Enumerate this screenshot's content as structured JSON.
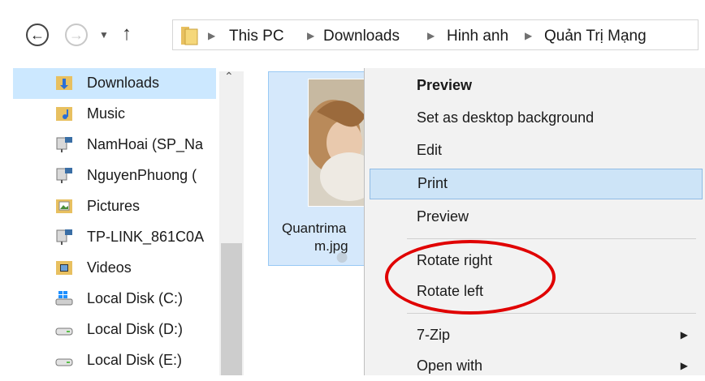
{
  "address_bar": {
    "back_icon": "back-arrow-icon",
    "forward_icon": "forward-arrow-icon",
    "recent_icon": "chevron-down-icon",
    "up_icon": "up-arrow-icon",
    "folder_icon": "folder-icon",
    "breadcrumbs": [
      "This PC",
      "Downloads",
      "Hinh anh",
      "Quản Trị Mạng"
    ]
  },
  "sidebar": {
    "items": [
      {
        "label": "Downloads",
        "icon": "downloads-folder-icon",
        "selected": true
      },
      {
        "label": "Music",
        "icon": "music-folder-icon"
      },
      {
        "label": "NamHoai (SP_Na",
        "icon": "network-drive-icon"
      },
      {
        "label": "NguyenPhuong (",
        "icon": "network-drive-icon"
      },
      {
        "label": "Pictures",
        "icon": "pictures-folder-icon"
      },
      {
        "label": "TP-LINK_861C0A",
        "icon": "network-drive-icon"
      },
      {
        "label": "Videos",
        "icon": "videos-folder-icon"
      },
      {
        "label": "Local Disk (C:)",
        "icon": "windows-drive-icon"
      },
      {
        "label": "Local Disk (D:)",
        "icon": "drive-icon"
      },
      {
        "label": "Local Disk (E:)",
        "icon": "drive-icon"
      }
    ]
  },
  "file": {
    "name_line1": "Quantrima",
    "name_line2": "m.jpg"
  },
  "context_menu": {
    "items": [
      {
        "label": "Preview",
        "bold": true
      },
      {
        "label": "Set as desktop background"
      },
      {
        "label": "Edit"
      },
      {
        "label": "Print",
        "hover": true
      },
      {
        "label": "Preview"
      },
      {
        "label": "Rotate right"
      },
      {
        "label": "Rotate left"
      },
      {
        "label": "7-Zip",
        "submenu": true
      },
      {
        "label": "Open with",
        "submenu": true
      }
    ]
  },
  "colors": {
    "selection": "#cce8ff",
    "menu_hover": "#cde4f7",
    "highlight_ellipse": "#e00000"
  }
}
